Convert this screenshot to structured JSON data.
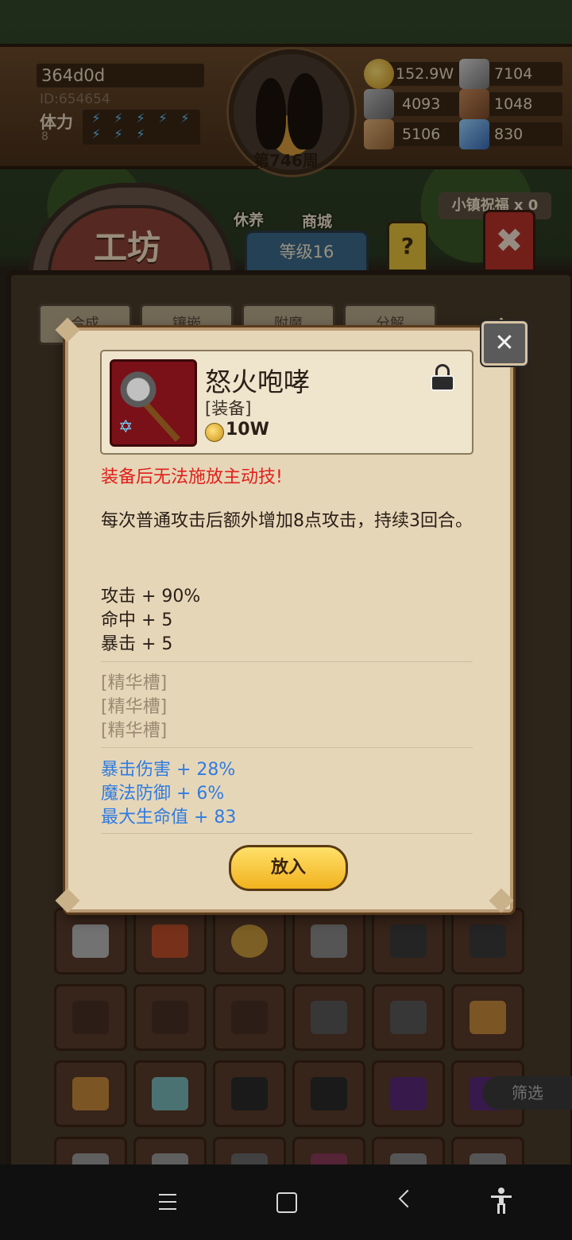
{
  "player": {
    "name": "364d0d",
    "id_label": "ID:654654",
    "stamina_label": "体力",
    "stamina_value": "8",
    "week": "第746周"
  },
  "resources": {
    "gold": "152.9W",
    "res2": "7104",
    "res3": "4093",
    "res4": "1048",
    "res5": "5106",
    "res6": "830"
  },
  "nav": {
    "rest": "休养",
    "shop": "商城",
    "town_blessing": "小镇祝福 x 0"
  },
  "workshop": {
    "title": "工坊",
    "level": "等级16",
    "help": "?",
    "tabs": [
      "合成",
      "镶嵌",
      "附魔",
      "分解"
    ],
    "filter": "筛选"
  },
  "item": {
    "name": "怒火咆哮",
    "type": "[装备]",
    "price": "10W",
    "warning": "装备后无法施放主动技!",
    "description": "每次普通攻击后额外增加8点攻击，持续3回合。",
    "stats": [
      "攻击 + 90%",
      "命中 + 5",
      "暴击 + 5"
    ],
    "slots": [
      "[精华槽]",
      "[精华槽]",
      "[精华槽]"
    ],
    "bonuses": [
      "暴击伤害 + 28%",
      "魔法防御 + 6%",
      "最大生命值 + 83"
    ],
    "action": "放入"
  }
}
